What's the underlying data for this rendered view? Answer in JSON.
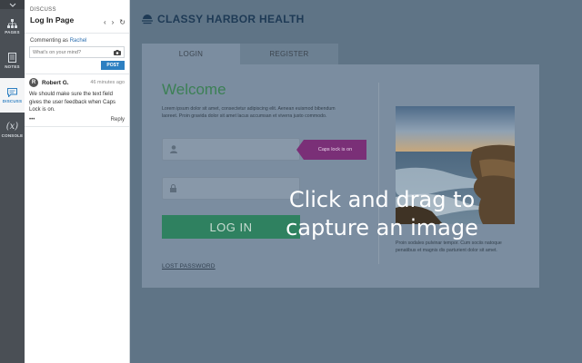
{
  "rail": {
    "items": [
      {
        "label": "PAGES",
        "icon": "sitemap-icon"
      },
      {
        "label": "NOTES",
        "icon": "notes-icon"
      },
      {
        "label": "DISCUSS",
        "icon": "chat-icon"
      },
      {
        "label": "CONSOLE",
        "icon": "fx-icon",
        "glyph": "(x)"
      }
    ]
  },
  "discuss": {
    "kicker": "DISCUSS",
    "title": "Log In Page",
    "commenting_prefix": "Commenting as",
    "commenting_name": "Rachel",
    "input_placeholder": "What's on your mind?",
    "post_label": "POST",
    "comment": {
      "avatar": "R",
      "author": "Robert G.",
      "time": "46 minutes ago",
      "text": "We should make sure the text field gives the user feedback when Caps Lock is on.",
      "more": "•••",
      "reply": "Reply"
    }
  },
  "site": {
    "brand": "CLASSY HARBOR HEALTH",
    "tabs": [
      "LOGIN",
      "REGISTER"
    ],
    "welcome": "Welcome",
    "lorem": "Lorem ipsum dolor sit amet, consectetur adipiscing elit. Aenean euismod bibendum laoreet. Proin gravida dolor sit amet lacus accumsan et viverra justo commodo.",
    "caps_lock": "Caps lock is on",
    "login_label": "LOG IN",
    "lost_password": "LOST PASSWORD",
    "caption": "Proin sodales pulvinar tempor. Cum sociis natoque penatibus et magnis dis parturient dolor sit amet."
  },
  "overlay": {
    "line1": "Click and drag to",
    "line2": "capture an image"
  },
  "colors": {
    "accent_blue": "#2d7fc1",
    "welcome_green": "#3c8055",
    "caps_purple": "#7a2f77",
    "button_green": "#2f8160"
  }
}
